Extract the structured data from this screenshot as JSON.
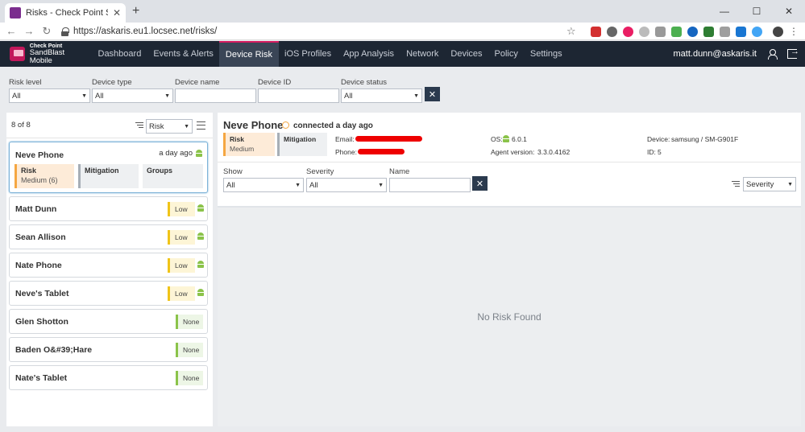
{
  "browser": {
    "tab_title": "Risks - Check Point SandBlast Mo",
    "url": "https://askaris.eu1.locsec.net/risks/"
  },
  "app": {
    "logo_top": "Check Point",
    "logo_bottom": "SandBlast Mobile",
    "nav": [
      "Dashboard",
      "Events & Alerts",
      "Device Risk",
      "iOS Profiles",
      "App Analysis",
      "Network",
      "Devices",
      "Policy",
      "Settings"
    ],
    "active_nav": "Device Risk",
    "user": "matt.dunn@askaris.it",
    "brand_color": "#d81b60"
  },
  "filters": {
    "risk_level": {
      "label": "Risk level",
      "value": "All"
    },
    "device_type": {
      "label": "Device type",
      "value": "All"
    },
    "device_name": {
      "label": "Device name",
      "value": ""
    },
    "device_id": {
      "label": "Device ID",
      "value": ""
    },
    "device_status": {
      "label": "Device status",
      "value": "All"
    }
  },
  "device_list": {
    "count": "8 of 8",
    "sort": "Risk",
    "selected": {
      "name": "Neve Phone",
      "time": "a day ago",
      "risk_title": "Risk",
      "risk_value": "Medium (6)",
      "mitigation_title": "Mitigation",
      "groups_title": "Groups"
    },
    "devices": [
      {
        "name": "Matt Dunn",
        "level": "Low"
      },
      {
        "name": "Sean Allison",
        "level": "Low"
      },
      {
        "name": "Nate Phone",
        "level": "Low"
      },
      {
        "name": "Neve's Tablet",
        "level": "Low"
      },
      {
        "name": "Glen Shotton",
        "level": "None"
      },
      {
        "name": "Baden O&#39;Hare",
        "level": "None"
      },
      {
        "name": "Nate's Tablet",
        "level": "None"
      }
    ]
  },
  "device_detail": {
    "name": "Neve Phone",
    "status": "connected a day ago",
    "risk_title": "Risk",
    "risk_value": "Medium",
    "mitigation_title": "Mitigation",
    "email_label": "Email:",
    "phone_label": "Phone:",
    "os_label": "OS:",
    "os_value": "6.0.1",
    "agent_label": "Agent version:",
    "agent_value": "3.3.0.4162",
    "device_label": "Device:",
    "device_value": "samsung / SM-G901F",
    "id_label": "ID:",
    "id_value": "5"
  },
  "risk_filters": {
    "show": {
      "label": "Show",
      "value": "All"
    },
    "severity": {
      "label": "Severity",
      "value": "All"
    },
    "name": {
      "label": "Name",
      "value": ""
    },
    "sort": "Severity"
  },
  "empty_message": "No Risk Found",
  "icons": [
    "close-icon",
    "back-arrow-icon",
    "forward-arrow-icon",
    "reload-icon",
    "lock-icon",
    "star-icon",
    "user-icon",
    "logout-icon",
    "sort-icon",
    "list-icon",
    "android-icon",
    "status-circle-icon",
    "clear-x-icon"
  ]
}
